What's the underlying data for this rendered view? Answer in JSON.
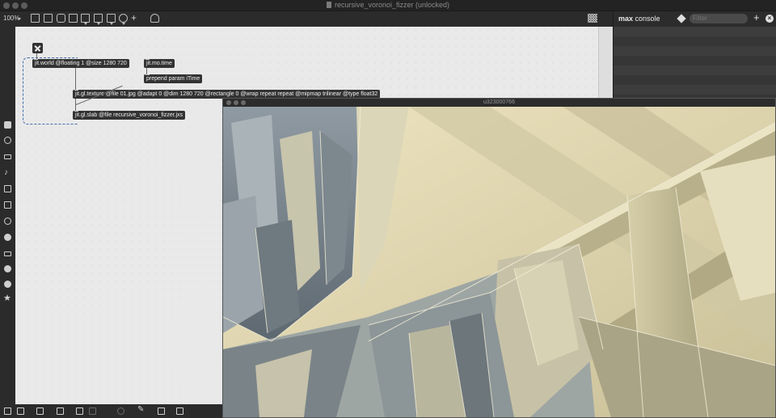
{
  "window": {
    "title": "recursive_voronoi_fizzer (unlocked)"
  },
  "toolbar": {
    "zoom": "100%",
    "tools": [
      "presentation-icon",
      "patcher-icon",
      "comment-icon",
      "message-icon",
      "object-icon",
      "button-icon",
      "toggle-icon",
      "dial-icon",
      "add-icon",
      "paint-icon"
    ]
  },
  "console": {
    "title_bold": "max",
    "title_rest": "console",
    "filter_placeholder": "Filter"
  },
  "patcher": {
    "objects": {
      "world": "jit.world @floating 1 @size 1280 720",
      "mo_time": "jit.mo.time",
      "prepend": "prepend param iTime",
      "texture": "jit.gl.texture @file 01.jpg @adapt 0 @dim 1280 720 @rectangle 0 @wrap repeat repeat @mipmap trilinear @type float32",
      "slab": "jit.gl.slab @file recursive_voronoi_fizzer.jxs"
    }
  },
  "render_window": {
    "title": "u323000766"
  },
  "colors": {
    "canvas": "#e9e9e9",
    "object_bg": "#333333",
    "loop_cord": "#3f6fa8",
    "chrome": "#2b2b2b"
  }
}
